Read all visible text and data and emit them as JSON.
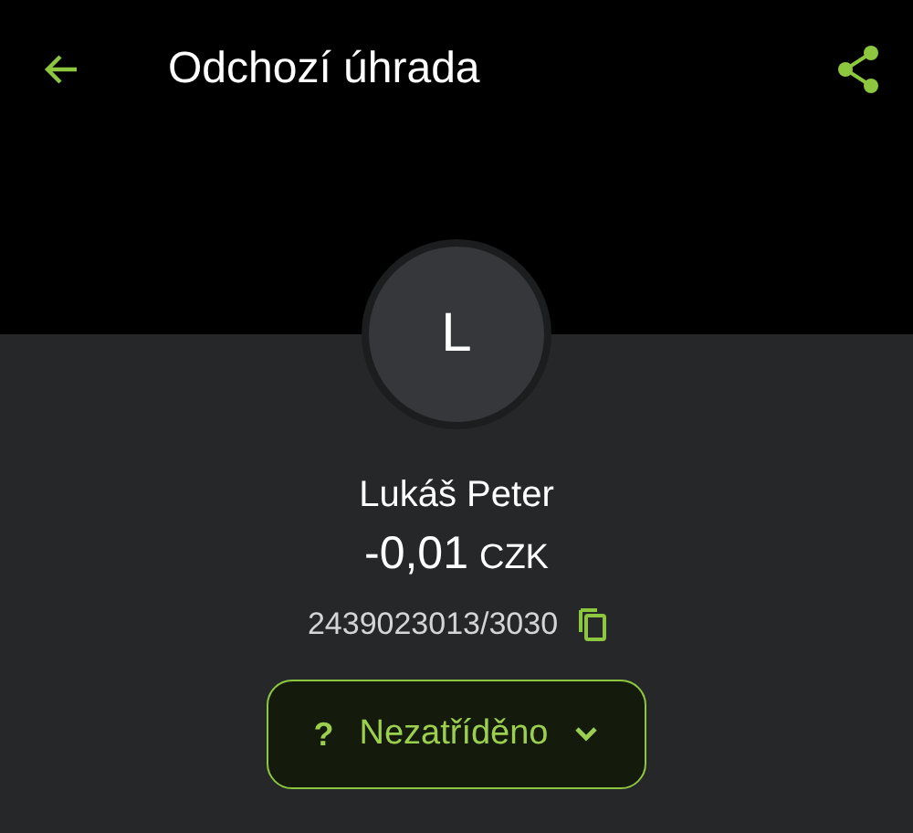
{
  "header": {
    "title": "Odchozí úhrada"
  },
  "avatar": {
    "initial": "L"
  },
  "payee": {
    "name": "Lukáš Peter",
    "amount": "-0,01",
    "currency": "CZK",
    "account": "2439023013/3030"
  },
  "category": {
    "symbol": "?",
    "label": "Nezatříděno"
  }
}
